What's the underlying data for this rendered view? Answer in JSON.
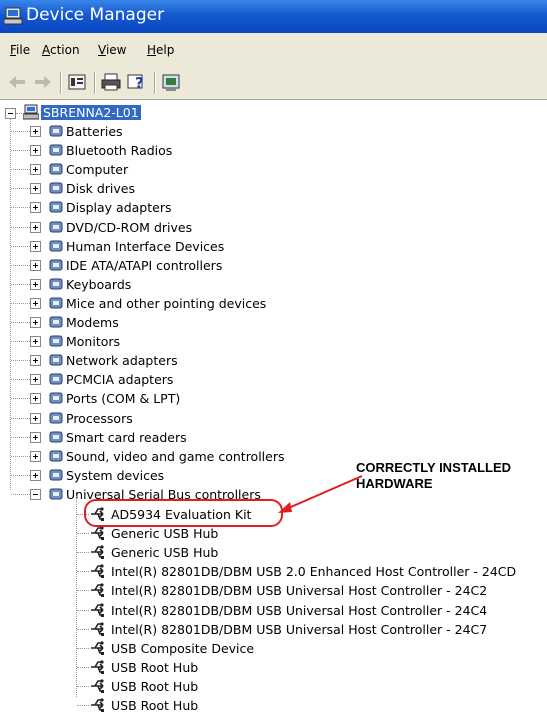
{
  "window": {
    "title": "Device Manager",
    "icon": "device-manager-icon"
  },
  "menu": {
    "items": [
      "File",
      "Action",
      "View",
      "Help"
    ],
    "underlines": [
      "F",
      "A",
      "V",
      "H"
    ]
  },
  "toolbar": {
    "buttons": [
      "back-arrow-icon",
      "forward-arrow-icon",
      "properties-icon",
      "print-icon",
      "help-icon",
      "scan-hardware-icon"
    ]
  },
  "tree": {
    "root": "SBRENNA2-L01",
    "categories": [
      {
        "label": "Batteries",
        "icon": "battery-icon"
      },
      {
        "label": "Bluetooth Radios",
        "icon": "bluetooth-icon"
      },
      {
        "label": "Computer",
        "icon": "computer-icon"
      },
      {
        "label": "Disk drives",
        "icon": "disk-drive-icon"
      },
      {
        "label": "Display adapters",
        "icon": "display-adapter-icon"
      },
      {
        "label": "DVD/CD-ROM drives",
        "icon": "cdrom-icon"
      },
      {
        "label": "Human Interface Devices",
        "icon": "hid-icon"
      },
      {
        "label": "IDE ATA/ATAPI controllers",
        "icon": "ide-controller-icon"
      },
      {
        "label": "Keyboards",
        "icon": "keyboard-icon"
      },
      {
        "label": "Mice and other pointing devices",
        "icon": "mouse-icon"
      },
      {
        "label": "Modems",
        "icon": "modem-icon"
      },
      {
        "label": "Monitors",
        "icon": "monitor-icon"
      },
      {
        "label": "Network adapters",
        "icon": "network-adapter-icon"
      },
      {
        "label": "PCMCIA adapters",
        "icon": "pcmcia-icon"
      },
      {
        "label": "Ports (COM & LPT)",
        "icon": "port-icon"
      },
      {
        "label": "Processors",
        "icon": "processor-icon"
      },
      {
        "label": "Smart card readers",
        "icon": "smart-card-icon"
      },
      {
        "label": "Sound, video and game controllers",
        "icon": "sound-icon"
      },
      {
        "label": "System devices",
        "icon": "system-devices-icon"
      },
      {
        "label": "Universal Serial Bus controllers",
        "icon": "usb-icon"
      }
    ],
    "usb_children": [
      "AD5934 Evaluation Kit",
      "Generic USB Hub",
      "Generic USB Hub",
      "Intel(R) 82801DB/DBM USB 2.0 Enhanced Host Controller - 24CD",
      "Intel(R) 82801DB/DBM USB Universal Host Controller - 24C2",
      "Intel(R) 82801DB/DBM USB Universal Host Controller - 24C4",
      "Intel(R) 82801DB/DBM USB Universal Host Controller - 24C7",
      "USB Composite Device",
      "USB Root Hub",
      "USB Root Hub",
      "USB Root Hub"
    ]
  },
  "annotation": {
    "line1": "CORRECTLY INSTALLED",
    "line2": "HARDWARE",
    "color": "#e02020"
  },
  "colors": {
    "titlebar": "#0a46c0",
    "selection": "#316ac5",
    "chrome": "#ece9d8"
  }
}
